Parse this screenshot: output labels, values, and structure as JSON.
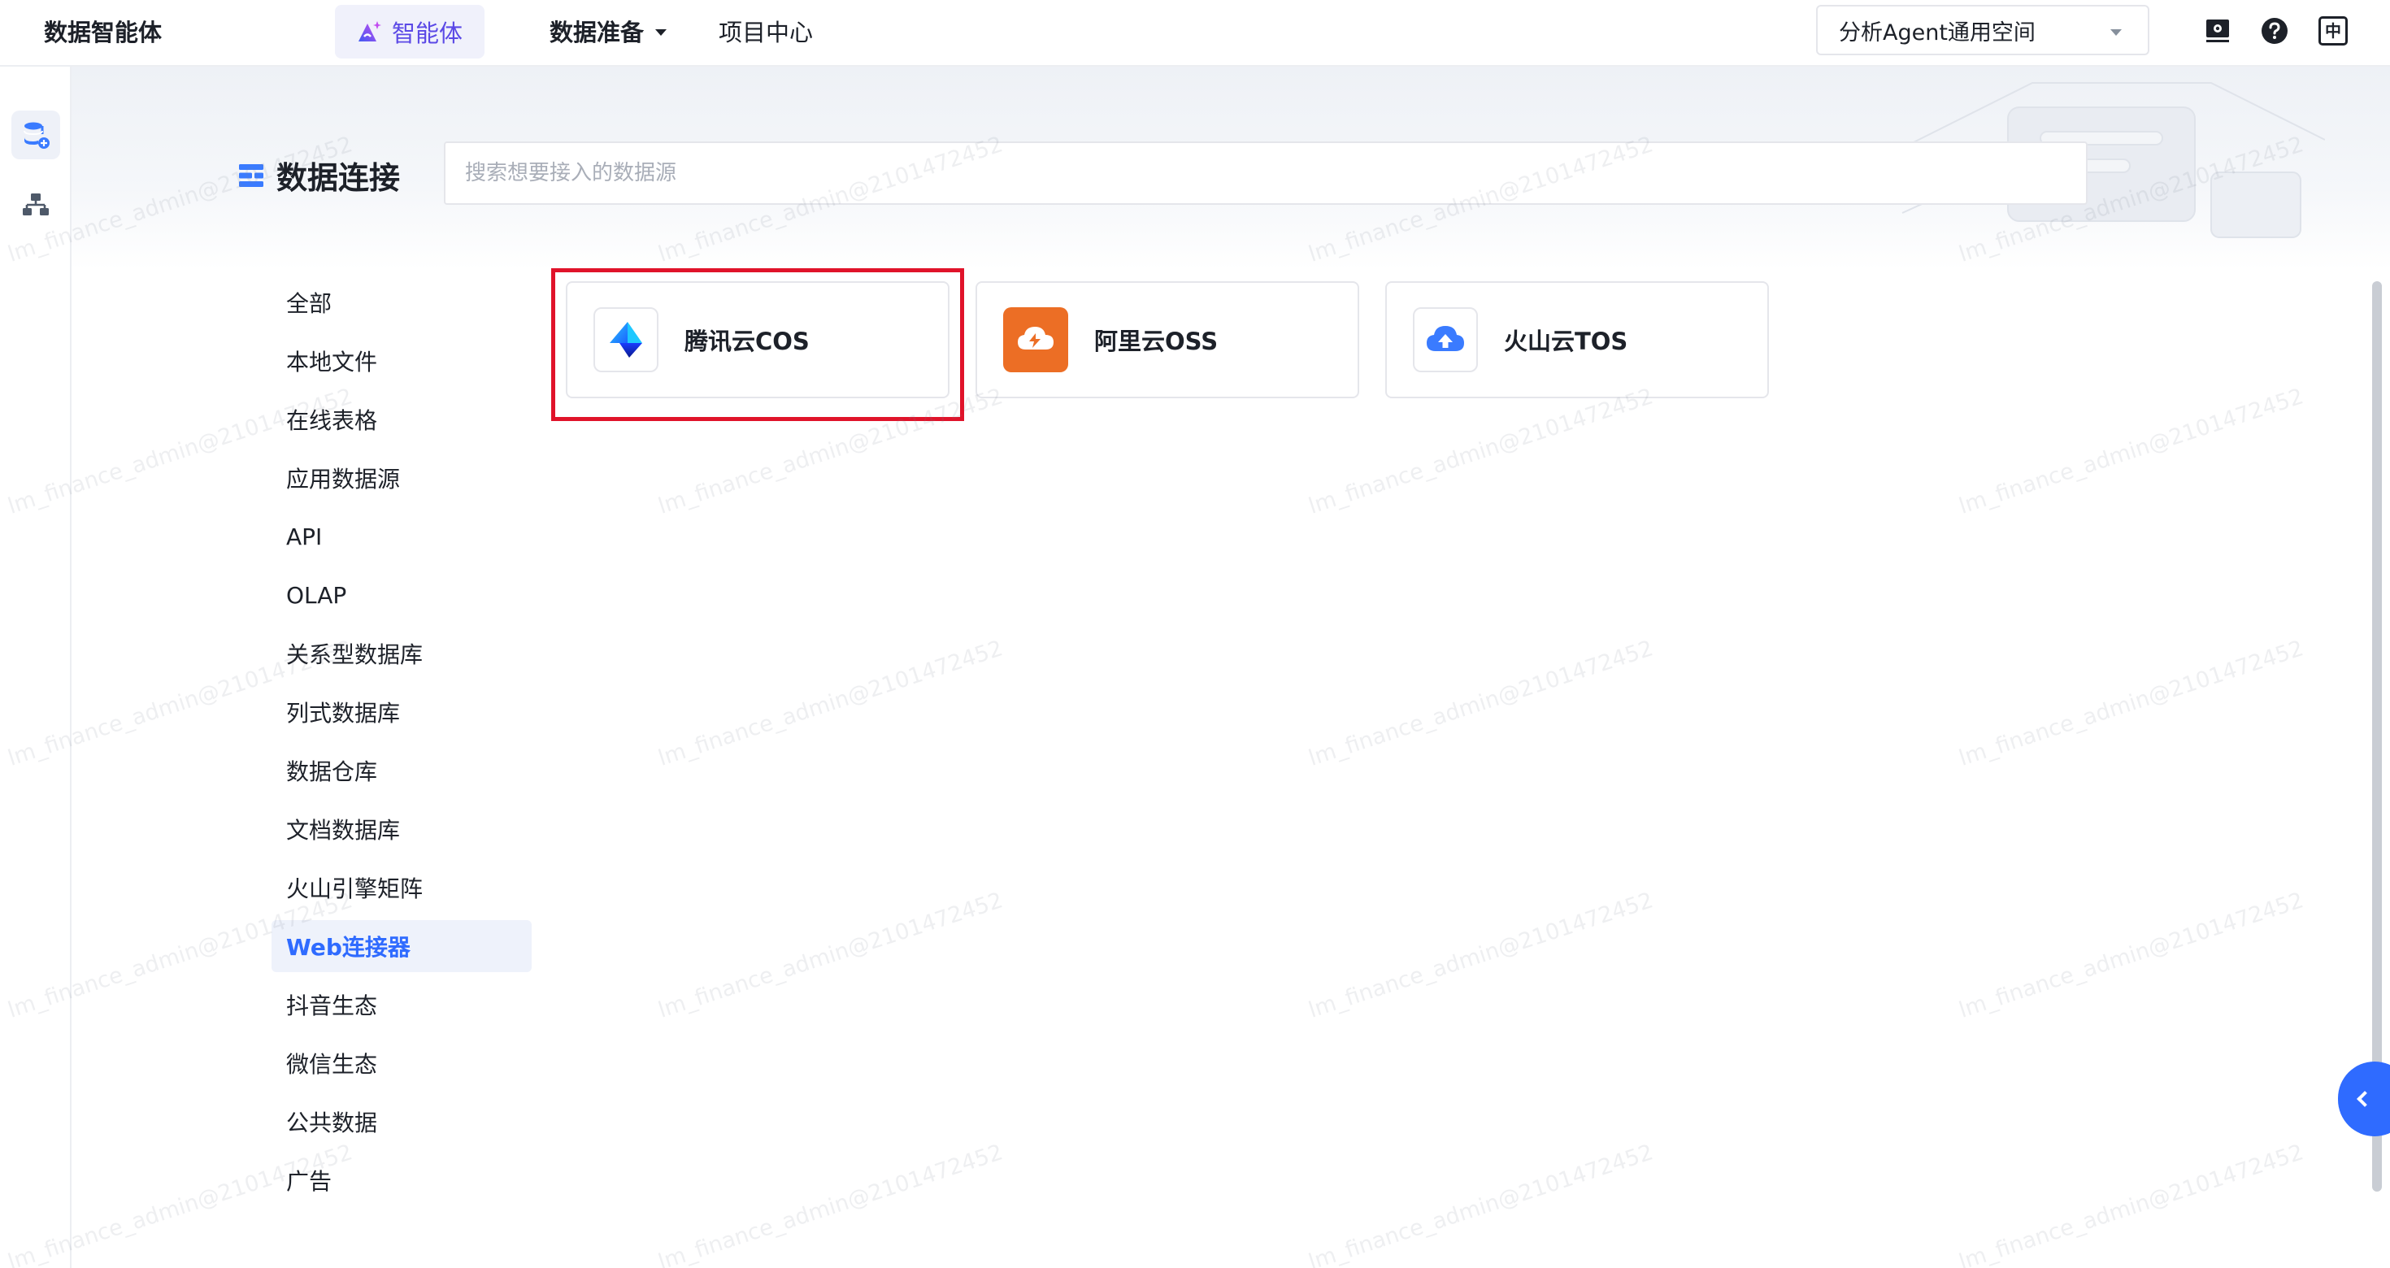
{
  "header": {
    "app_title": "数据智能体",
    "nav": {
      "agent_label": "智能体",
      "data_prep_label": "数据准备",
      "project_center_label": "项目中心"
    },
    "workspace_select": {
      "value": "分析Agent通用空间"
    },
    "icons": [
      "screen-record-icon",
      "help-icon",
      "language-icon"
    ],
    "language_label": "中"
  },
  "rail": {
    "items": [
      {
        "icon": "database-add-icon",
        "active": true
      },
      {
        "icon": "hierarchy-icon",
        "active": false
      }
    ]
  },
  "page": {
    "title": "数据连接",
    "search": {
      "placeholder": "搜索想要接入的数据源",
      "value": ""
    }
  },
  "categories": [
    {
      "label": "全部"
    },
    {
      "label": "本地文件"
    },
    {
      "label": "在线表格"
    },
    {
      "label": "应用数据源"
    },
    {
      "label": "API"
    },
    {
      "label": "OLAP"
    },
    {
      "label": "关系型数据库"
    },
    {
      "label": "列式数据库"
    },
    {
      "label": "数据仓库"
    },
    {
      "label": "文档数据库"
    },
    {
      "label": "火山引擎矩阵"
    },
    {
      "label": "Web连接器",
      "active": true
    },
    {
      "label": "抖音生态"
    },
    {
      "label": "微信生态"
    },
    {
      "label": "公共数据"
    },
    {
      "label": "广告"
    }
  ],
  "connectors": [
    {
      "name": "腾讯云COS",
      "icon": "tencent-cos-icon",
      "highlighted": true
    },
    {
      "name": "阿里云OSS",
      "icon": "aliyun-oss-icon",
      "color": "#ec6e25"
    },
    {
      "name": "火山云TOS",
      "icon": "volcano-tos-icon",
      "color": "#3a7bff"
    }
  ],
  "watermark": "lm_finance_admin@2101472452",
  "colors": {
    "accent": "#2f6bff",
    "highlight_border": "#e0132a",
    "agent_purple": "#5b49e6"
  }
}
